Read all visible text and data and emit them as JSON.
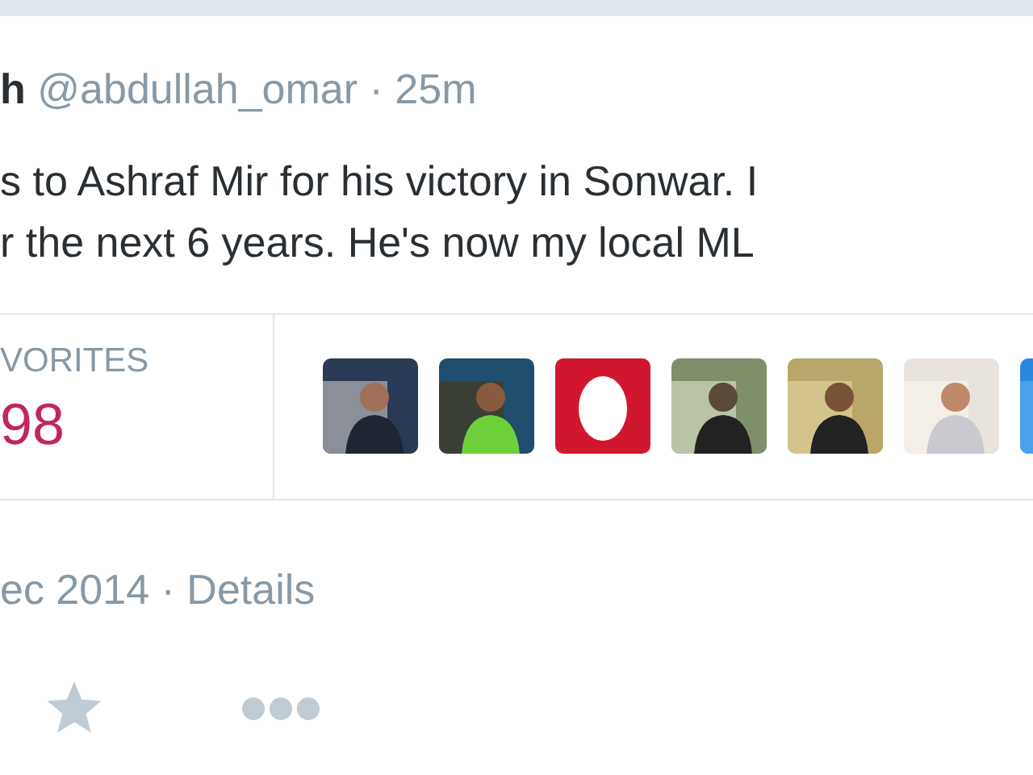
{
  "tweet": {
    "author_name": "h",
    "handle": "@abdullah_omar",
    "separator": "·",
    "time": "25m",
    "text_lines": [
      "s to Ashraf Mir for his victory in Sonwar. I",
      "r the next 6 years. He's now my local ML"
    ]
  },
  "stats": {
    "label": "VORITES",
    "count": "98"
  },
  "favoriters": [
    {
      "kind": "picture"
    },
    {
      "kind": "picture"
    },
    {
      "kind": "default"
    },
    {
      "kind": "picture"
    },
    {
      "kind": "picture"
    },
    {
      "kind": "picture"
    },
    {
      "kind": "picture"
    }
  ],
  "footer": {
    "date": "ec 2014",
    "separator": "·",
    "details_link": "Details"
  }
}
